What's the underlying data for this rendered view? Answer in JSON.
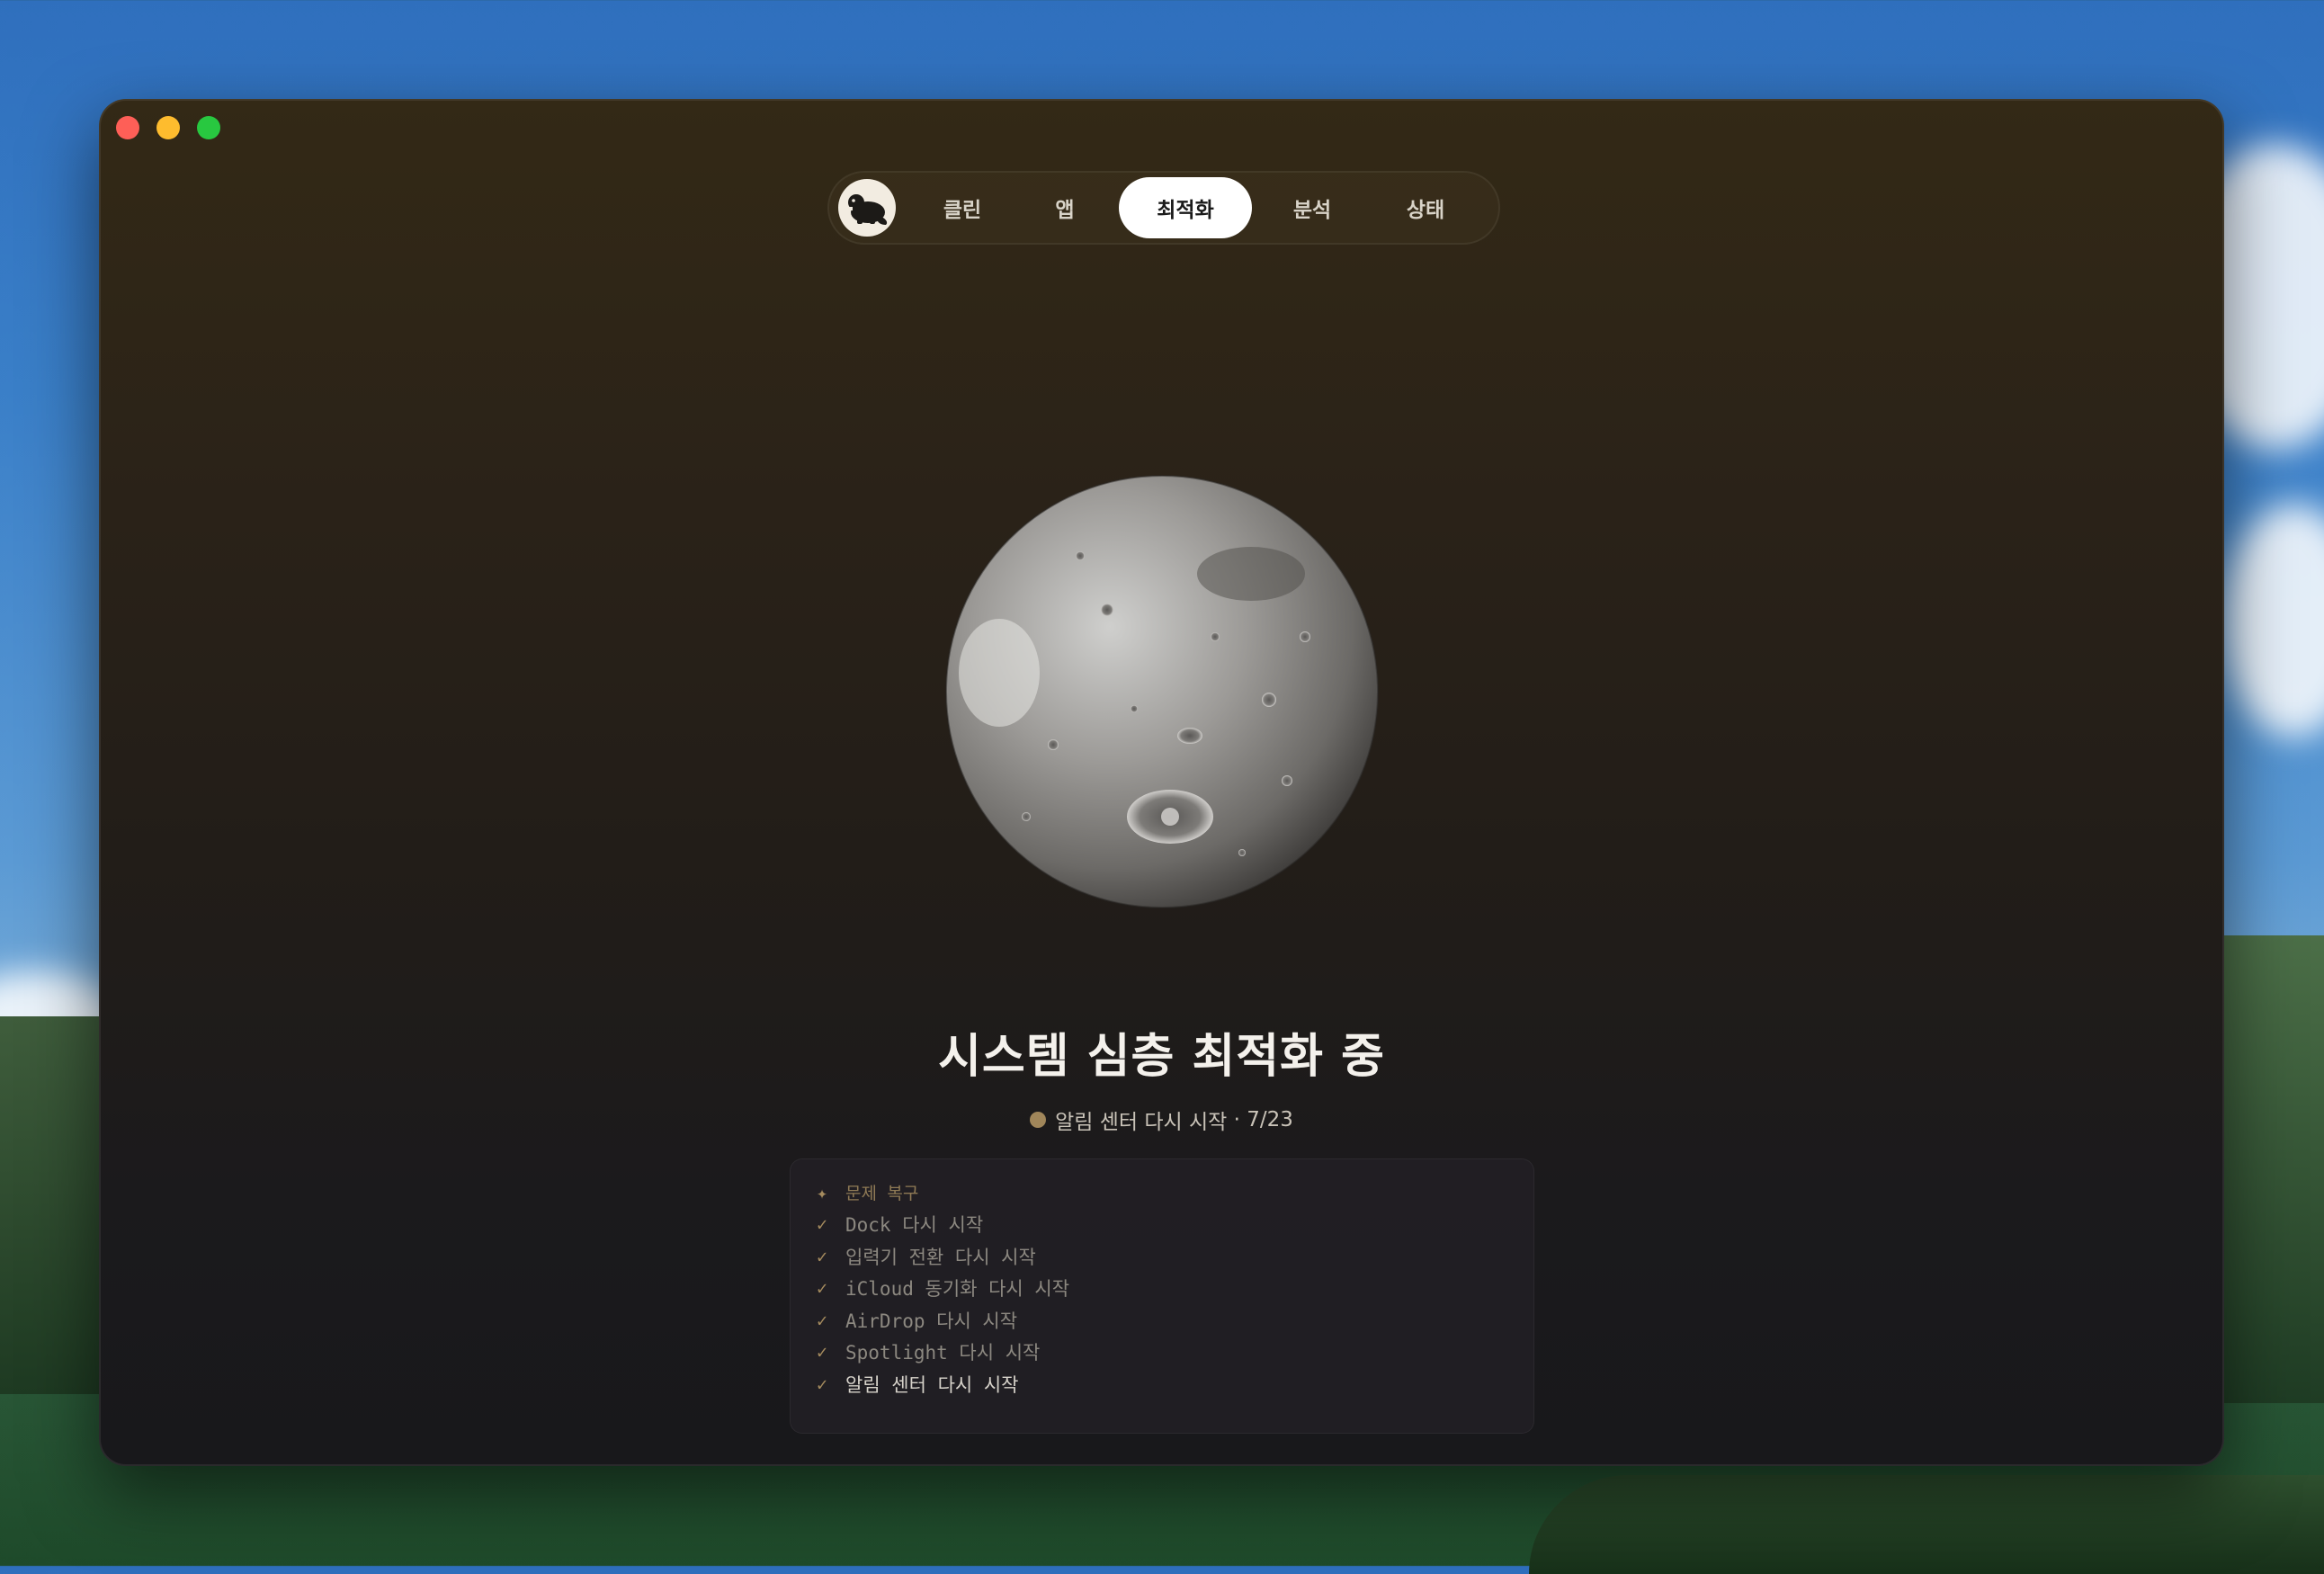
{
  "nav": {
    "logo_icon": "beaver-icon",
    "tabs": [
      {
        "label": "클린"
      },
      {
        "label": "앱"
      },
      {
        "label": "최적화",
        "active": true
      },
      {
        "label": "분석"
      },
      {
        "label": "상태"
      }
    ]
  },
  "main": {
    "title": "시스템 심층 최적화 중",
    "status_text": "알림 센터 다시 시작",
    "progress": "7/23",
    "progress_separator": " · "
  },
  "log": {
    "header": "문제 복구",
    "items": [
      "Dock 다시 시작",
      "입력기 전환 다시 시작",
      "iCloud 동기화 다시 시작",
      "AirDrop 다시 시작",
      "Spotlight 다시 시작",
      "알림 센터 다시 시작"
    ]
  },
  "colors": {
    "accent": "#a0865a",
    "active_tab_bg": "#ffffff"
  }
}
